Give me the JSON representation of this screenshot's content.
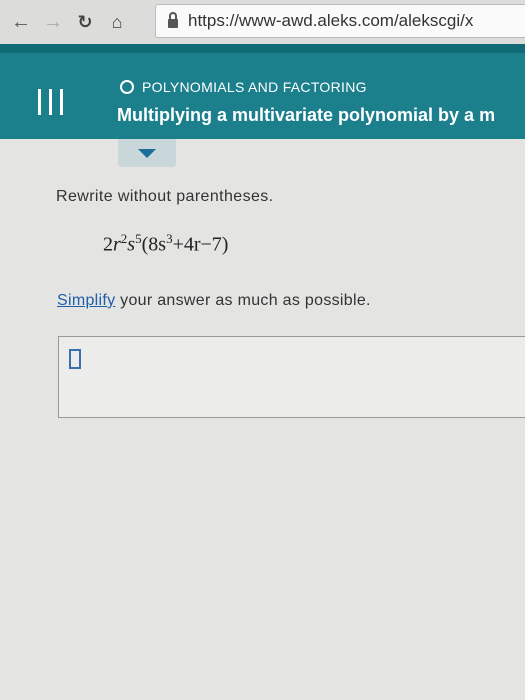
{
  "browser": {
    "url": "https://www-awd.aleks.com/alekscgi/x"
  },
  "header": {
    "section": "POLYNOMIALS AND FACTORING",
    "title": "Multiplying a multivariate polynomial by a m"
  },
  "problem": {
    "prompt": "Rewrite without parentheses.",
    "expression": {
      "coef": "2",
      "r": "r",
      "r_exp": "2",
      "s": "s",
      "s_exp": "5",
      "open": "(",
      "inner1": "8s",
      "inner1_exp": "3",
      "inner2": "+4r−7",
      "close": ")"
    },
    "simplify_link": "Simplify",
    "simplify_rest": " your answer as much as possible."
  },
  "answer": {
    "value": ""
  }
}
